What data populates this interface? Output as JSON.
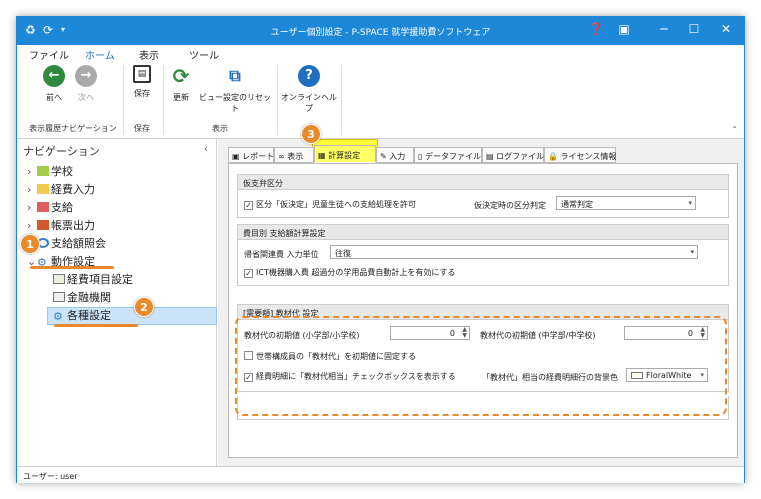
{
  "window": {
    "title": "ユーザー個別設定 - P-SPACE 就学援助費ソフトウェア"
  },
  "menu": [
    "ファイル",
    "ホーム",
    "表示",
    "ツール"
  ],
  "ribbon": {
    "back": "前へ",
    "forward": "次へ",
    "save": "保存",
    "refresh": "更新",
    "reset_view": "ビュー設定のリセット",
    "help": "オンラインヘルプ",
    "groups": {
      "nav": "表示履歴ナビゲーション",
      "save": "保存",
      "view": "表示"
    }
  },
  "sidebar": {
    "title": "ナビゲーション",
    "items": [
      "学校",
      "経費入力",
      "支給",
      "帳票出力",
      "支給額照会",
      "動作設定",
      "経費項目設定",
      "金融機関",
      "各種設定"
    ]
  },
  "tabs": [
    "レポート",
    "表示",
    "計算設定",
    "入力",
    "データファイル",
    "ログファイル",
    "ライセンス情報"
  ],
  "sections": {
    "provisional": {
      "title": "仮支弁区分",
      "checkbox": "区分「仮決定」児童生徒への支給処理を許可",
      "judge_label": "仮決定時の区分判定",
      "judge_value": "通常判定"
    },
    "cost": {
      "title": "費目別 支給額計算設定",
      "unit_label": "帰省関連費 入力単位",
      "unit_value": "往復",
      "ict_checkbox": "ICT機器購入費 超過分の学用品費自動計上を有効にする"
    },
    "material": {
      "title": "[需要額] 教材代 設定",
      "elem_label": "教材代の初期値 (小学部/小学校)",
      "elem_value": "0",
      "mid_label": "教材代の初期値 (中学部/中学校)",
      "mid_value": "0",
      "fix_checkbox": "世帯構成員の「教材代」を初期値に固定する",
      "show_checkbox": "経費明細に「教材代相当」チェックボックスを表示する",
      "bg_label": "「教材代」相当の経費明細行の背景色",
      "bg_value": "FloralWhite"
    }
  },
  "status": "ユーザー: user",
  "badges": [
    "1",
    "2",
    "3"
  ],
  "colors": {
    "accent": "#1e88d8",
    "annotation": "#e8892a",
    "highlight": "#ffff33"
  }
}
